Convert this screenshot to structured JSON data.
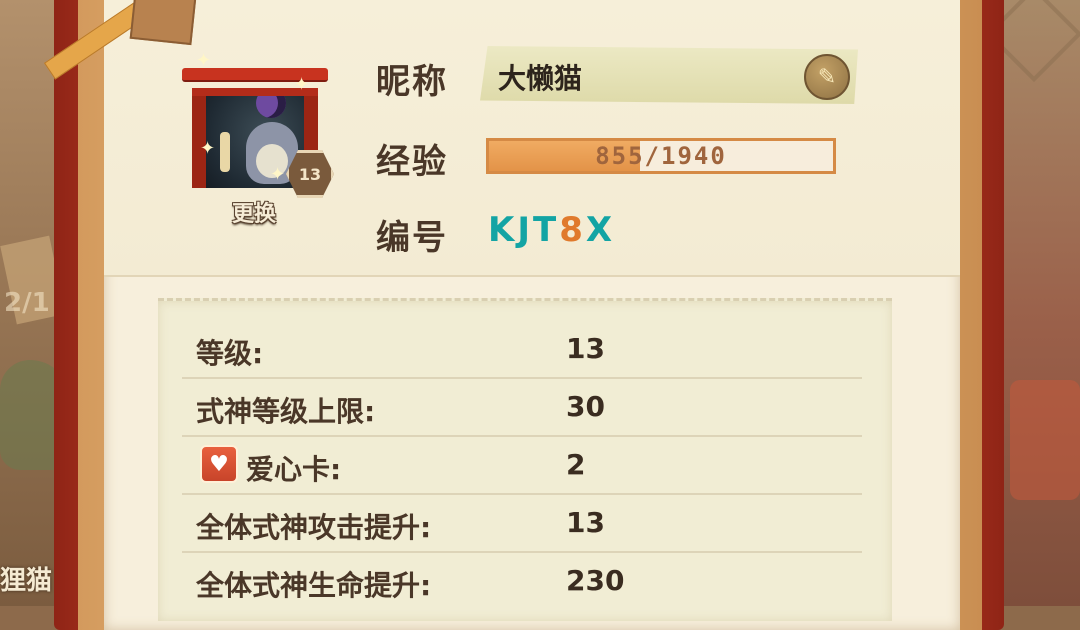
{
  "background": {
    "left_date_fragment": "2/1",
    "left_name_fragment": "狸猫"
  },
  "profile": {
    "change_label": "更换",
    "level_badge": "13",
    "nickname_label": "昵称",
    "nickname_value": "大懒猫",
    "exp_label": "经验",
    "exp_current": 855,
    "exp_max": 1940,
    "exp_text": "855/1940",
    "exp_fraction": 0.44,
    "id_label": "编号",
    "id_prefix": "KJT",
    "id_highlight": "8",
    "id_suffix": "X"
  },
  "stats": [
    {
      "label": "等级:",
      "value": "13"
    },
    {
      "label": "式神等级上限:",
      "value": "30"
    },
    {
      "label": "爱心卡:",
      "value": "2"
    },
    {
      "label": "全体式神攻击提升:",
      "value": "13"
    },
    {
      "label": "全体式神生命提升:",
      "value": "230"
    }
  ],
  "colors": {
    "frame_red": "#b53a22",
    "exp_fill": "#e39348",
    "id_teal": "#13a4a4",
    "id_orange": "#e07a2c"
  },
  "icons": {
    "edit": "brush-icon",
    "heart_card": "heart-card-icon",
    "sparkle": "sparkle-icon"
  }
}
